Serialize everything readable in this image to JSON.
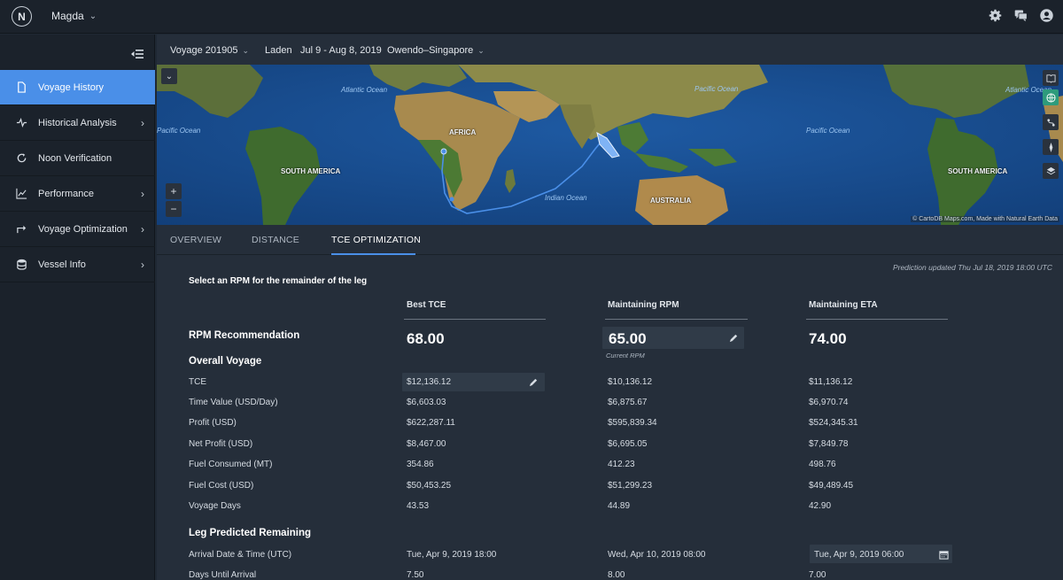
{
  "app": {
    "logo": "N",
    "user": "Magda"
  },
  "icons": {
    "settings": "gear-icon",
    "messages": "chat-icon",
    "account": "user-icon"
  },
  "sidebar": {
    "items": [
      {
        "label": "Voyage History",
        "icon": "document-icon",
        "active": true,
        "has_arrow": false
      },
      {
        "label": "Historical Analysis",
        "icon": "pulse-icon",
        "active": false,
        "has_arrow": true
      },
      {
        "label": "Noon Verification",
        "icon": "refresh-icon",
        "active": false,
        "has_arrow": false
      },
      {
        "label": "Performance",
        "icon": "chart-icon",
        "active": false,
        "has_arrow": true
      },
      {
        "label": "Voyage Optimization",
        "icon": "route-icon",
        "active": false,
        "has_arrow": true
      },
      {
        "label": "Vessel Info",
        "icon": "database-icon",
        "active": false,
        "has_arrow": true
      }
    ]
  },
  "voyage": {
    "name": "Voyage 201905",
    "status": "Laden",
    "dates": "Jul 9 - Aug 8, 2019",
    "route": "Owendo–Singapore"
  },
  "map": {
    "labels": {
      "atlantic": "Atlantic Ocean",
      "pacific_left": "Pacific Ocean",
      "pacific_top": "Pacific Ocean",
      "pacific_right": "Pacific Ocean",
      "atlantic_right": "Atlantic Ocean",
      "indian": "Indian Ocean",
      "africa": "AFRICA",
      "south_america": "SOUTH AMERICA",
      "south_america_right": "SOUTH AMERICA",
      "australia": "AUSTRALIA"
    },
    "attribution": "© CartoDB Maps.com, Made with Natural Earth Data",
    "zoom_in": "+",
    "zoom_out": "−"
  },
  "tabs": [
    {
      "label": "OVERVIEW",
      "active": false
    },
    {
      "label": "DISTANCE",
      "active": false
    },
    {
      "label": "TCE OPTIMIZATION",
      "active": true
    }
  ],
  "tce": {
    "prediction_updated": "Prediction updated  Thu Jul 18, 2019 18:00 UTC",
    "instruction": "Select an RPM for the remainder of the leg",
    "columns": [
      "Best TCE",
      "Maintaining RPM",
      "Maintaining ETA"
    ],
    "rpm_label": "RPM Recommendation",
    "rpm_values": [
      "68.00",
      "65.00",
      "74.00"
    ],
    "current_rpm_label": "Current RPM",
    "overall_heading": "Overall Voyage",
    "overall_rows": [
      {
        "label": "TCE",
        "values": [
          "$12,136.12",
          "$10,136.12",
          "$11,136.12"
        ]
      },
      {
        "label": "Time Value (USD/Day)",
        "values": [
          "$6,603.03",
          "$6,875.67",
          "$6,970.74"
        ]
      },
      {
        "label": "Profit (USD)",
        "values": [
          "$622,287.11",
          "$595,839.34",
          "$524,345.31"
        ]
      },
      {
        "label": "Net Profit (USD)",
        "values": [
          "$8,467.00",
          "$6,695.05",
          "$7,849.78"
        ]
      },
      {
        "label": "Fuel Consumed (MT)",
        "values": [
          "354.86",
          "412.23",
          "498.76"
        ]
      },
      {
        "label": "Fuel Cost (USD)",
        "values": [
          "$50,453.25",
          "$51,299.23",
          "$49,489.45"
        ]
      },
      {
        "label": "Voyage Days",
        "values": [
          "43.53",
          "44.89",
          "42.90"
        ]
      }
    ],
    "leg_heading": "Leg Predicted Remaining",
    "leg_rows": [
      {
        "label": "Arrival Date & Time (UTC)",
        "values": [
          "Tue, Apr 9, 2019 18:00",
          "Wed, Apr 10, 2019 08:00",
          "Tue, Apr 9, 2019 06:00"
        ]
      },
      {
        "label": "Days Until Arrival",
        "values": [
          "7.50",
          "8.00",
          "7.00"
        ]
      }
    ]
  }
}
